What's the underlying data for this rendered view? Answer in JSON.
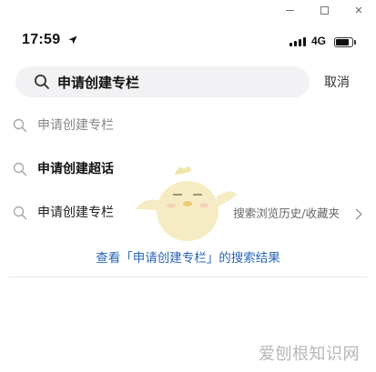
{
  "window": {
    "controls": [
      "minimize",
      "maximize",
      "close"
    ],
    "close_glyph": "✕"
  },
  "status_bar": {
    "time": "17:59",
    "network": "4G"
  },
  "search": {
    "query": "申请创建专栏",
    "cancel_label": "取消"
  },
  "suggestions": [
    {
      "label": "申请创建专栏",
      "style": "muted"
    },
    {
      "label": "申请创建超话",
      "style": "bold"
    },
    {
      "label": "申请创建专栏",
      "style": "normal",
      "extra": "搜索浏览历史/收藏夹"
    }
  ],
  "result_link": "查看「申请创建专栏」的搜索结果",
  "watermark": "爱刨根知识网",
  "colors": {
    "link": "#2a66b8",
    "search_bg": "#f2f2f4",
    "mascot": "#f5e9b8"
  }
}
